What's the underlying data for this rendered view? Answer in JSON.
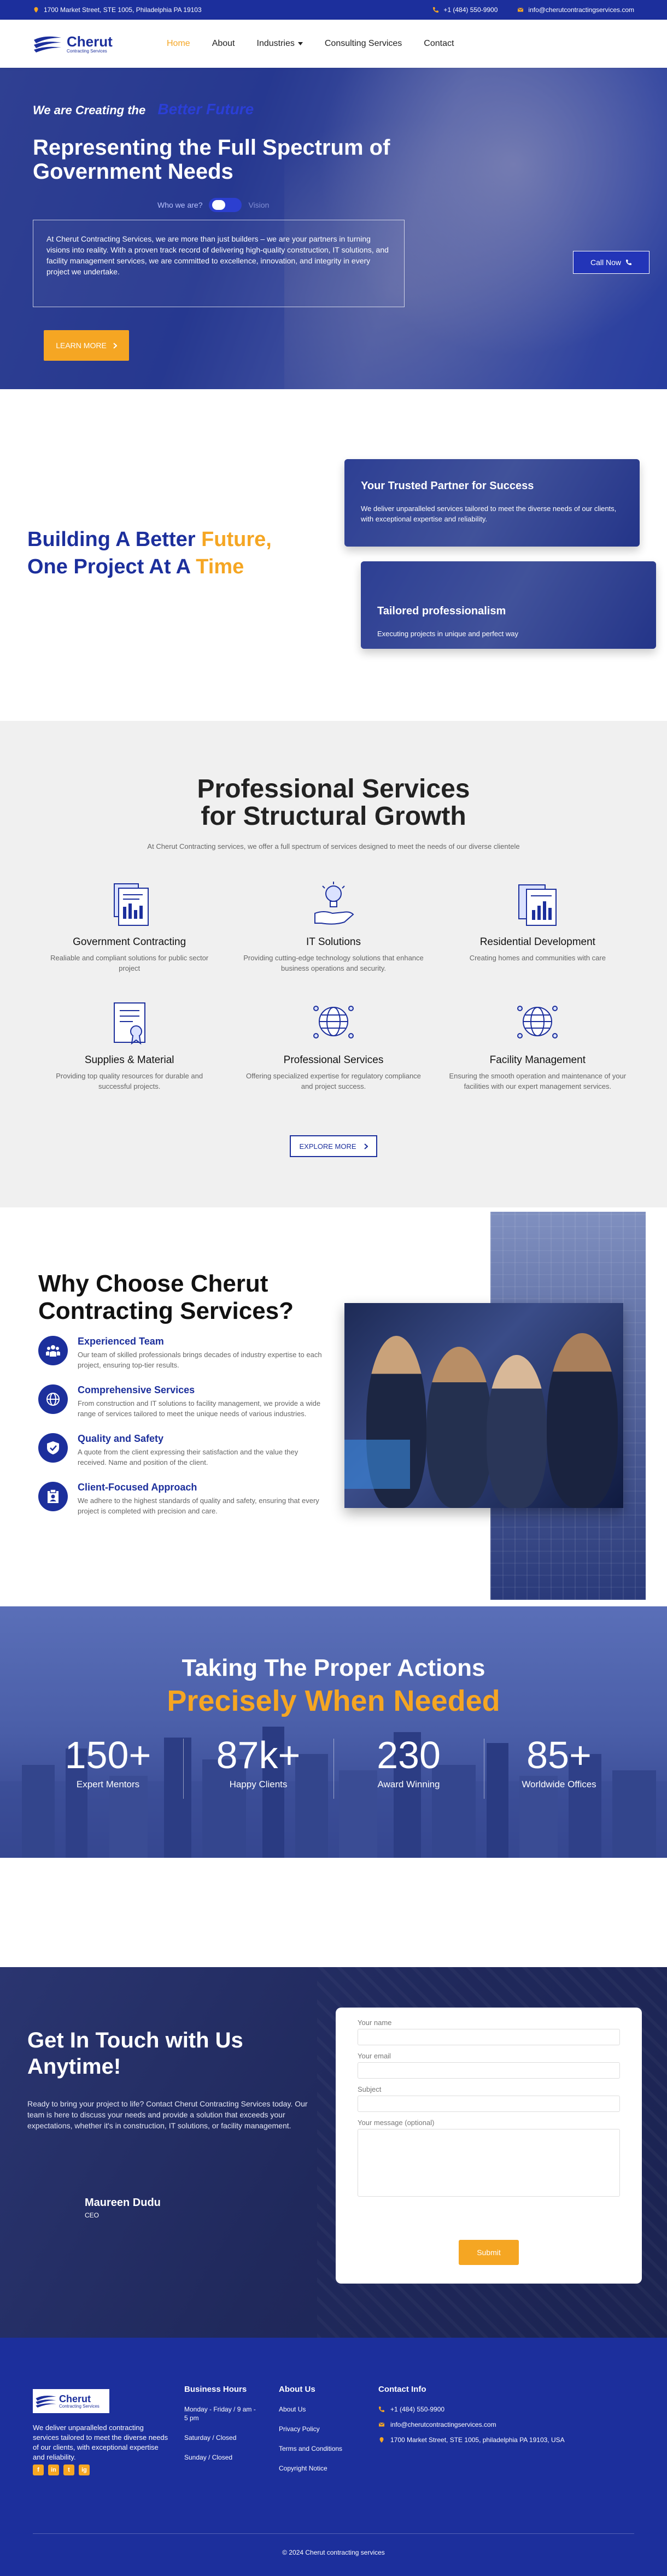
{
  "topbar": {
    "address": "1700 Market Street, STE 1005, Philadelphia PA 19103",
    "phone": "+1 (484) 550-9900",
    "email": "info@cherutcontractingservices.com"
  },
  "brand": {
    "name": "Cherut",
    "tagline": "Contracting Services"
  },
  "nav": {
    "items": [
      "Home",
      "About",
      "Industries",
      "Consulting Services",
      "Contact"
    ]
  },
  "hero": {
    "kicker": "We are Creating the",
    "kicker_highlight": "Better Future",
    "title": "Representing the Full Spectrum of Government Needs",
    "toggle_left": "Who we are?",
    "toggle_right": "Vision",
    "body": "At Cherut Contracting Services, we are more than just builders – we are your partners in turning visions into reality. With a proven track record of delivering high-quality construction, IT solutions, and facility management services, we are committed to excellence, innovation, and integrity in every project we undertake.",
    "cta": "LEARN MORE",
    "call": "Call Now"
  },
  "build": {
    "line1": "Building A Better",
    "line1_highlight": "Future,",
    "line2": "One Project At A",
    "line2_highlight": "Time",
    "cards": [
      {
        "title": "Your Trusted Partner for Success",
        "text": "We deliver unparalleled services tailored to meet the diverse needs of our clients, with exceptional expertise and reliability."
      },
      {
        "title": "Tailored professionalism",
        "text": "Executing projects in unique and perfect way"
      }
    ]
  },
  "services": {
    "title_line1": "Professional Services",
    "title_line2": "for Structural Growth",
    "subtitle": "At Cherut Contracting services, we offer a full spectrum of services designed to meet the needs of our diverse clientele",
    "items": [
      {
        "name": "Government Contracting",
        "desc": "Realiable and compliant solutions for public sector project",
        "icon": "document-chart-icon"
      },
      {
        "name": "IT Solutions",
        "desc": "Providing cutting-edge technology solutions that enhance business operations and security.",
        "icon": "lightbulb-hand-icon"
      },
      {
        "name": "Residential Development",
        "desc": "Creating homes and communities with care",
        "icon": "documents-chart-icon"
      },
      {
        "name": "Supplies & Material",
        "desc": "Providing top quality resources for durable and successful projects.",
        "icon": "certificate-icon"
      },
      {
        "name": "Professional Services",
        "desc": "Offering specialized expertise for regulatory compliance and project success.",
        "icon": "globe-network-icon"
      },
      {
        "name": "Facility Management",
        "desc": "Ensuring the smooth operation and maintenance of your facilities with our expert management services.",
        "icon": "globe-network-icon"
      }
    ],
    "cta": "EXPLORE MORE"
  },
  "why": {
    "title_line1": "Why Choose Cherut",
    "title_line2": "Contracting Services?",
    "items": [
      {
        "name": "Experienced Team",
        "desc": "Our team of skilled professionals brings decades of industry expertise to each project, ensuring top-tier results."
      },
      {
        "name": "Comprehensive Services",
        "desc": "From construction and IT solutions to facility management, we provide a wide range of services tailored to meet the unique needs of various industries."
      },
      {
        "name": "Quality and Safety",
        "desc": "A quote from the client expressing their satisfaction and the value they received. Name and position of the client."
      },
      {
        "name": "Client-Focused Approach",
        "desc": "We adhere to the highest standards of quality and safety, ensuring that every project is completed with precision and care."
      }
    ]
  },
  "stats": {
    "title": "Taking The Proper Actions",
    "subtitle": "Precisely When Needed",
    "items": [
      {
        "num": "150+",
        "label": "Expert Mentors"
      },
      {
        "num": "87k+",
        "label": "Happy Clients"
      },
      {
        "num": "230",
        "label": "Award Winning"
      },
      {
        "num": "85+",
        "label": "Worldwide Offices"
      }
    ]
  },
  "contact": {
    "title": "Get In Touch with Us Anytime!",
    "text": "Ready to bring your project to life? Contact Cherut Contracting Services today. Our team is here to discuss your needs and provide a solution that exceeds your expectations, whether it's in construction, IT solutions, or facility management.",
    "person_name": "Maureen Dudu",
    "person_role": "CEO",
    "form": {
      "name": "Your name",
      "email": "Your email",
      "subject": "Subject",
      "message": "Your message (optional)",
      "submit": "Submit"
    }
  },
  "footer": {
    "about": "We deliver unparalleled contracting services tailored to meet the diverse needs of our clients, with exceptional expertise and reliability.",
    "hours_title": "Business Hours",
    "hours": [
      "Monday - Friday / 9 am - 5 pm",
      "Saturday / Closed",
      "Sunday / Closed"
    ],
    "about_title": "About Us",
    "links": [
      "About Us",
      "Privacy Policy",
      "Terms and Conditions",
      "Copyright Notice"
    ],
    "contact_title": "Contact Info",
    "phone": "+1 (484) 550-9900",
    "email": "info@cherutcontractingservices.com",
    "address": "1700 Market Street, STE 1005, philadelphia PA 19103, USA",
    "social": [
      "f",
      "in",
      "t",
      "ig"
    ],
    "copyright": "© 2024 Cherut contracting services"
  },
  "colors": {
    "primary": "#1c2f9c",
    "accent": "#f5a623"
  }
}
